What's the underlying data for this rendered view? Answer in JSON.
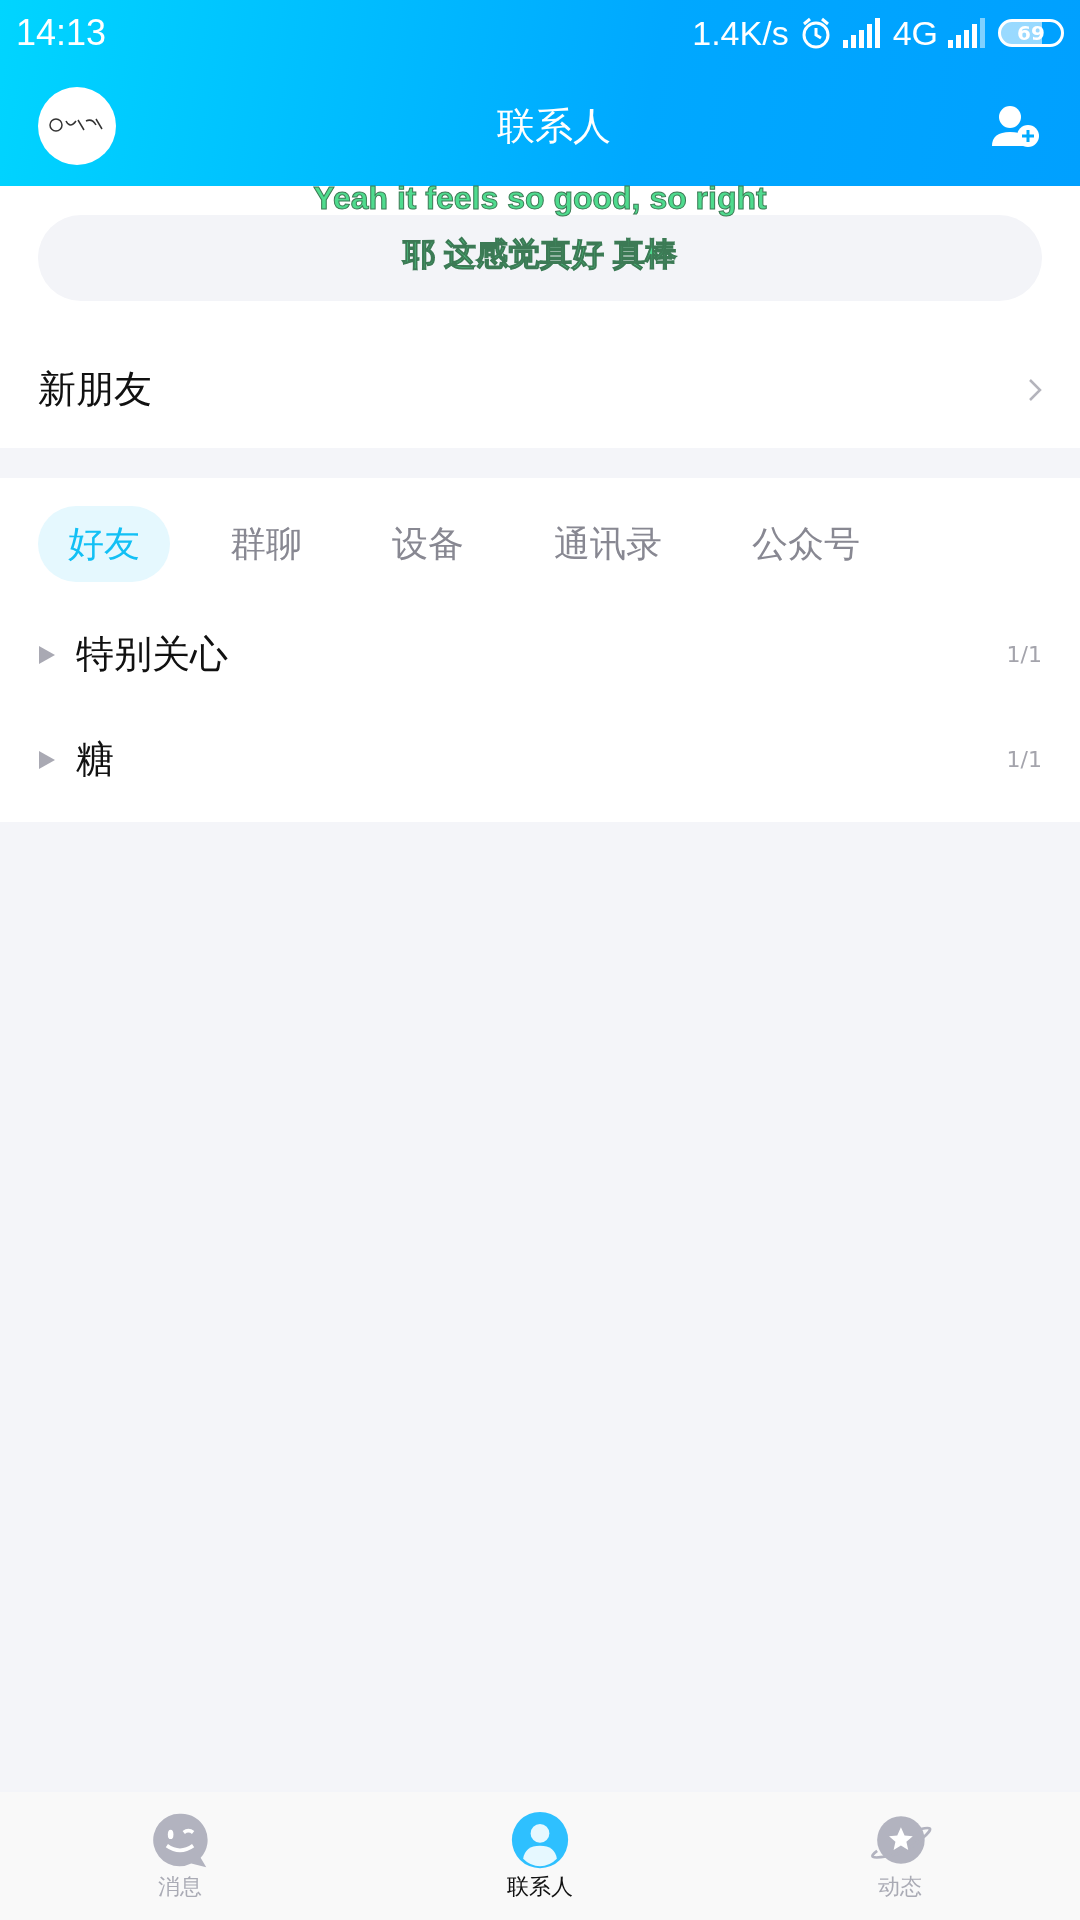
{
  "status_bar": {
    "time": "14:13",
    "speed": "1.4K/s",
    "network": "4G",
    "battery": "69"
  },
  "header": {
    "title": "联系人"
  },
  "lyrics": [
    "Yeah it feels so good, so right",
    "耶 这感觉真好 真棒"
  ],
  "new_friends": {
    "label": "新朋友"
  },
  "tabs": [
    {
      "label": "好友",
      "selected": true
    },
    {
      "label": "群聊",
      "selected": false
    },
    {
      "label": "设备",
      "selected": false
    },
    {
      "label": "通讯录",
      "selected": false
    },
    {
      "label": "公众号",
      "selected": false
    }
  ],
  "groups": [
    {
      "name": "特别关心",
      "count": "1/1",
      "expanded": false
    },
    {
      "name": "糖",
      "count": "1/1",
      "expanded": false
    }
  ],
  "bottom_nav": [
    {
      "label": "消息",
      "kind": "chat",
      "selected": false
    },
    {
      "label": "联系人",
      "kind": "contact",
      "selected": true
    },
    {
      "label": "动态",
      "kind": "planet",
      "selected": false
    }
  ]
}
